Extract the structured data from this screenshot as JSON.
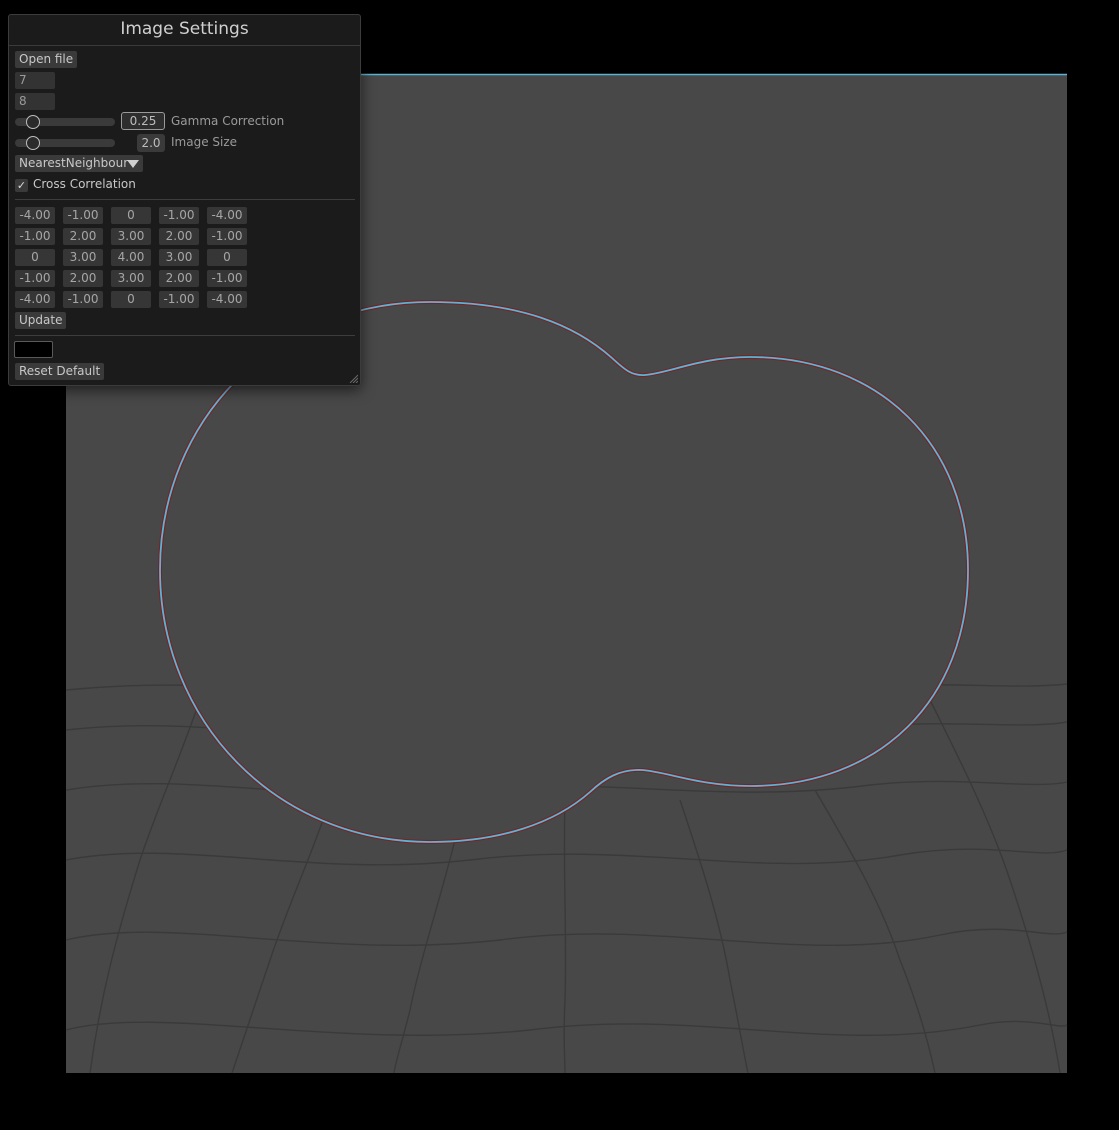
{
  "panel": {
    "title": "Image Settings",
    "open_file_label": "Open file",
    "width_value": "7",
    "height_value": "8",
    "gamma": {
      "value_text": "0.25",
      "label": "Gamma Correction",
      "level": 0.17
    },
    "image_size": {
      "value_text": "2.0",
      "label": "Image Size",
      "level": 0.17
    },
    "filter_select": "NearestNeighbour",
    "cross_correlation": {
      "label": "Cross Correlation",
      "checked": true,
      "check_glyph": "✓"
    },
    "kernel": [
      [
        "-4.00",
        "-1.00",
        "0",
        "-1.00",
        "-4.00"
      ],
      [
        "-1.00",
        "2.00",
        "3.00",
        "2.00",
        "-1.00"
      ],
      [
        "0",
        "3.00",
        "4.00",
        "3.00",
        "0"
      ],
      [
        "-1.00",
        "2.00",
        "3.00",
        "2.00",
        "-1.00"
      ],
      [
        "-4.00",
        "-1.00",
        "0",
        "-1.00",
        "-4.00"
      ]
    ],
    "update_label": "Update",
    "color_swatch": "#000000",
    "reset_label": "Reset Default"
  },
  "colors": {
    "background": "#000000",
    "image_fill": "#484848",
    "panel_bg": "#1b1b1b",
    "edge_cyan": "#5ab4d8",
    "edge_red": "#7a2222"
  },
  "icons": {
    "dropdown": "triangle-down-icon",
    "checkbox": "check-icon",
    "resize": "resize-grip-icon"
  }
}
